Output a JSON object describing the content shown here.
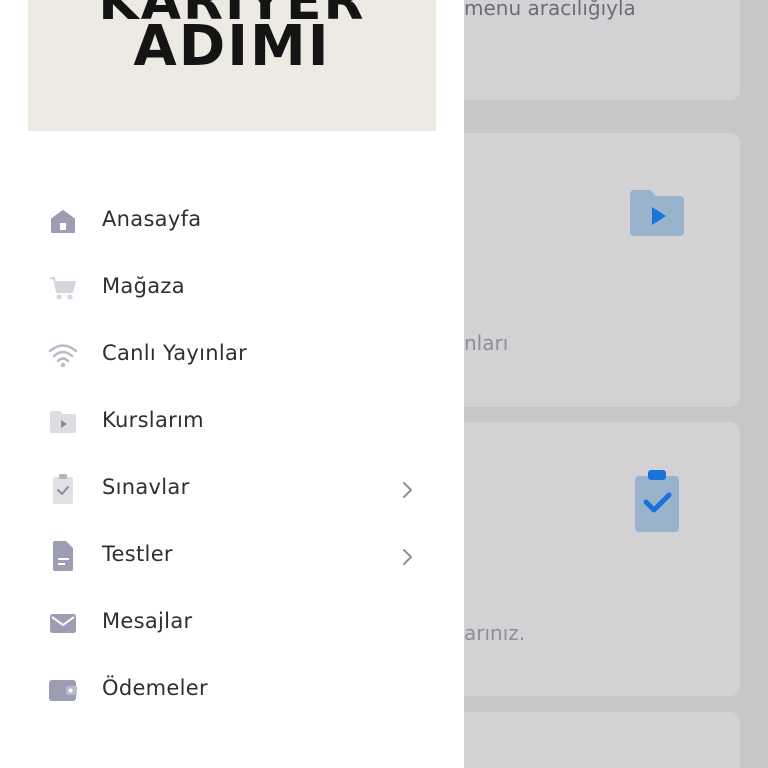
{
  "background": {
    "card1_text": "menu aracılığıyla",
    "card2_text": "nları",
    "card3_text": "arınız.",
    "card2_icon": "folder-play-icon",
    "card3_icon": "clipboard-check-icon",
    "accent_color": "#1a73d9"
  },
  "drawer": {
    "banner": {
      "line1": "KARİYER",
      "line2": "ADIMI"
    },
    "menu": [
      {
        "label": "Anasayfa",
        "icon": "home-icon",
        "has_submenu": false
      },
      {
        "label": "Mağaza",
        "icon": "cart-icon",
        "has_submenu": false
      },
      {
        "label": "Canlı Yayınlar",
        "icon": "wifi-icon",
        "has_submenu": false
      },
      {
        "label": "Kurslarım",
        "icon": "folder-play-icon",
        "has_submenu": false
      },
      {
        "label": "Sınavlar",
        "icon": "clipboard-check-icon",
        "has_submenu": true
      },
      {
        "label": "Testler",
        "icon": "document-icon",
        "has_submenu": true
      },
      {
        "label": "Mesajlar",
        "icon": "mail-icon",
        "has_submenu": false
      },
      {
        "label": "Ödemeler",
        "icon": "wallet-icon",
        "has_submenu": false
      }
    ]
  }
}
